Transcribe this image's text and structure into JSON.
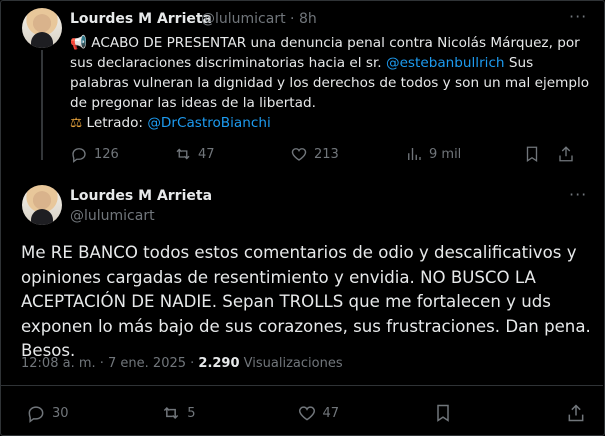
{
  "tweet1": {
    "name": "Lourdes M Arrieta",
    "handle": "@lulumicart",
    "time": "8h",
    "icon": "megaphone-icon",
    "text_a": "ACABO DE PRESENTAR una denuncia penal contra Nicolás Márquez, por sus declaraciones discriminatorias hacia el sr. ",
    "mention1": "@estebanbullrich",
    "text_b": " Sus palabras vulneran la dignidad y los derechos de todos y son un mal ejemplo de pregonar las ideas de la libertad.",
    "letrado_label": "Letrado: ",
    "mention2": "@DrCastroBianchi",
    "replies": "126",
    "reposts": "47",
    "likes": "213",
    "views": "9 mil"
  },
  "tweet2": {
    "name": "Lourdes M Arrieta",
    "handle": "@lulumicart",
    "text": "Me RE BANCO todos estos comentarios de odio y descalificativos y opiniones cargadas de resentimiento y envidia. NO BUSCO LA ACEPTACIÓN DE NADIE. Sepan TROLLS que me fortalecen y uds exponen lo más bajo de sus corazones, sus frustraciones. Dan pena. Besos.",
    "timestamp": "12:08 a. m. · 7 ene. 2025 · ",
    "views_count": "2.290",
    "views_label": " Visualizaciones",
    "replies": "30",
    "reposts": "5",
    "likes": "47"
  },
  "colors": {
    "link": "#1d9bf0",
    "muted": "#71767b",
    "text": "#e7e9ea",
    "background": "#000000"
  }
}
